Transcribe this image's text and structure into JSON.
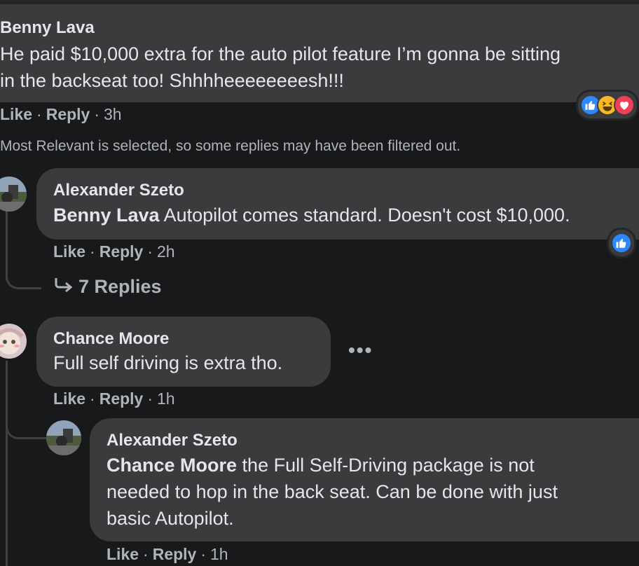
{
  "comment1": {
    "author": "Benny Lava",
    "text_line1": "He paid $10,000 extra for the auto pilot feature I’m gonna be sitting",
    "text_line2": "in the backseat too! Shhhheeeeeeeesh!!!",
    "like": "Like",
    "reply": "Reply",
    "time": "3h",
    "reactions": [
      "like-reaction-icon",
      "haha-reaction-icon",
      "love-reaction-icon"
    ]
  },
  "filter_note": "Most Relevant is selected, so some replies may have been filtered out.",
  "reply1": {
    "author": "Alexander Szeto",
    "mention": "Benny Lava",
    "text": " Autopilot comes standard. Doesn't cost $10,000.",
    "like": "Like",
    "reply": "Reply",
    "time": "2h",
    "replies_link": "7 Replies",
    "reactions": [
      "like-reaction-icon"
    ]
  },
  "reply2": {
    "author": "Chance Moore",
    "text": "Full self driving is extra tho.",
    "like": "Like",
    "reply": "Reply",
    "time": "1h",
    "more": "•••"
  },
  "reply3": {
    "author": "Alexander Szeto",
    "mention": "Chance Moore",
    "text_line1": " the Full Self-Driving package is not",
    "text_line2": "needed to hop in the back seat. Can be done with just",
    "text_line3": "basic Autopilot.",
    "like": "Like",
    "reply": "Reply",
    "time": "1h"
  },
  "colors": {
    "background": "#18191a",
    "bubble": "#3a3b3c",
    "text": "#e4e6eb",
    "secondary": "#b0b3b8",
    "like_blue": "#2d88ff",
    "love_red": "#f33e58",
    "haha_yellow": "#f7b928"
  }
}
